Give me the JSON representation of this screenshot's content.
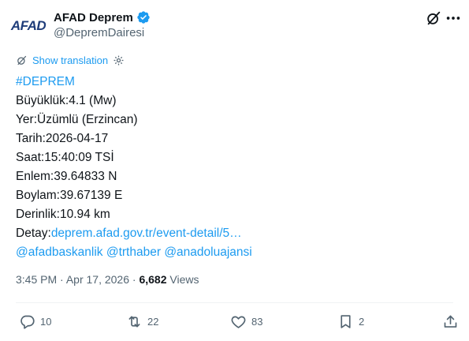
{
  "author": {
    "logo_text": "AFAD",
    "display_name": "AFAD Deprem",
    "handle": "@DepremDairesi",
    "verified_color": "#1d9bf0"
  },
  "translation": {
    "label": "Show translation"
  },
  "body": {
    "hashtag": "#DEPREM",
    "magnitude": "Büyüklük:4.1 (Mw)",
    "location": "Yer:Üzümlü (Erzincan)",
    "date": "Tarih:2026-04-17",
    "time": "Saat:15:40:09 TSİ",
    "latitude": "Enlem:39.64833 N",
    "longitude": "Boylam:39.67139 E",
    "depth": "Derinlik:10.94 km",
    "detail_label": "Detay:",
    "detail_link": "deprem.afad.gov.tr/event-detail/5…",
    "mentions": [
      "@afadbaskanlik",
      "@trthaber",
      "@anadoluajansi"
    ]
  },
  "meta": {
    "time": "3:45 PM",
    "separator": "·",
    "date": "Apr 17, 2026",
    "views_count": "6,682",
    "views_label": "Views"
  },
  "actions": {
    "replies": "10",
    "retweets": "22",
    "likes": "83",
    "bookmarks": "2"
  },
  "colors": {
    "link": "#1d9bf0",
    "text": "#0f1419",
    "muted": "#536471"
  }
}
